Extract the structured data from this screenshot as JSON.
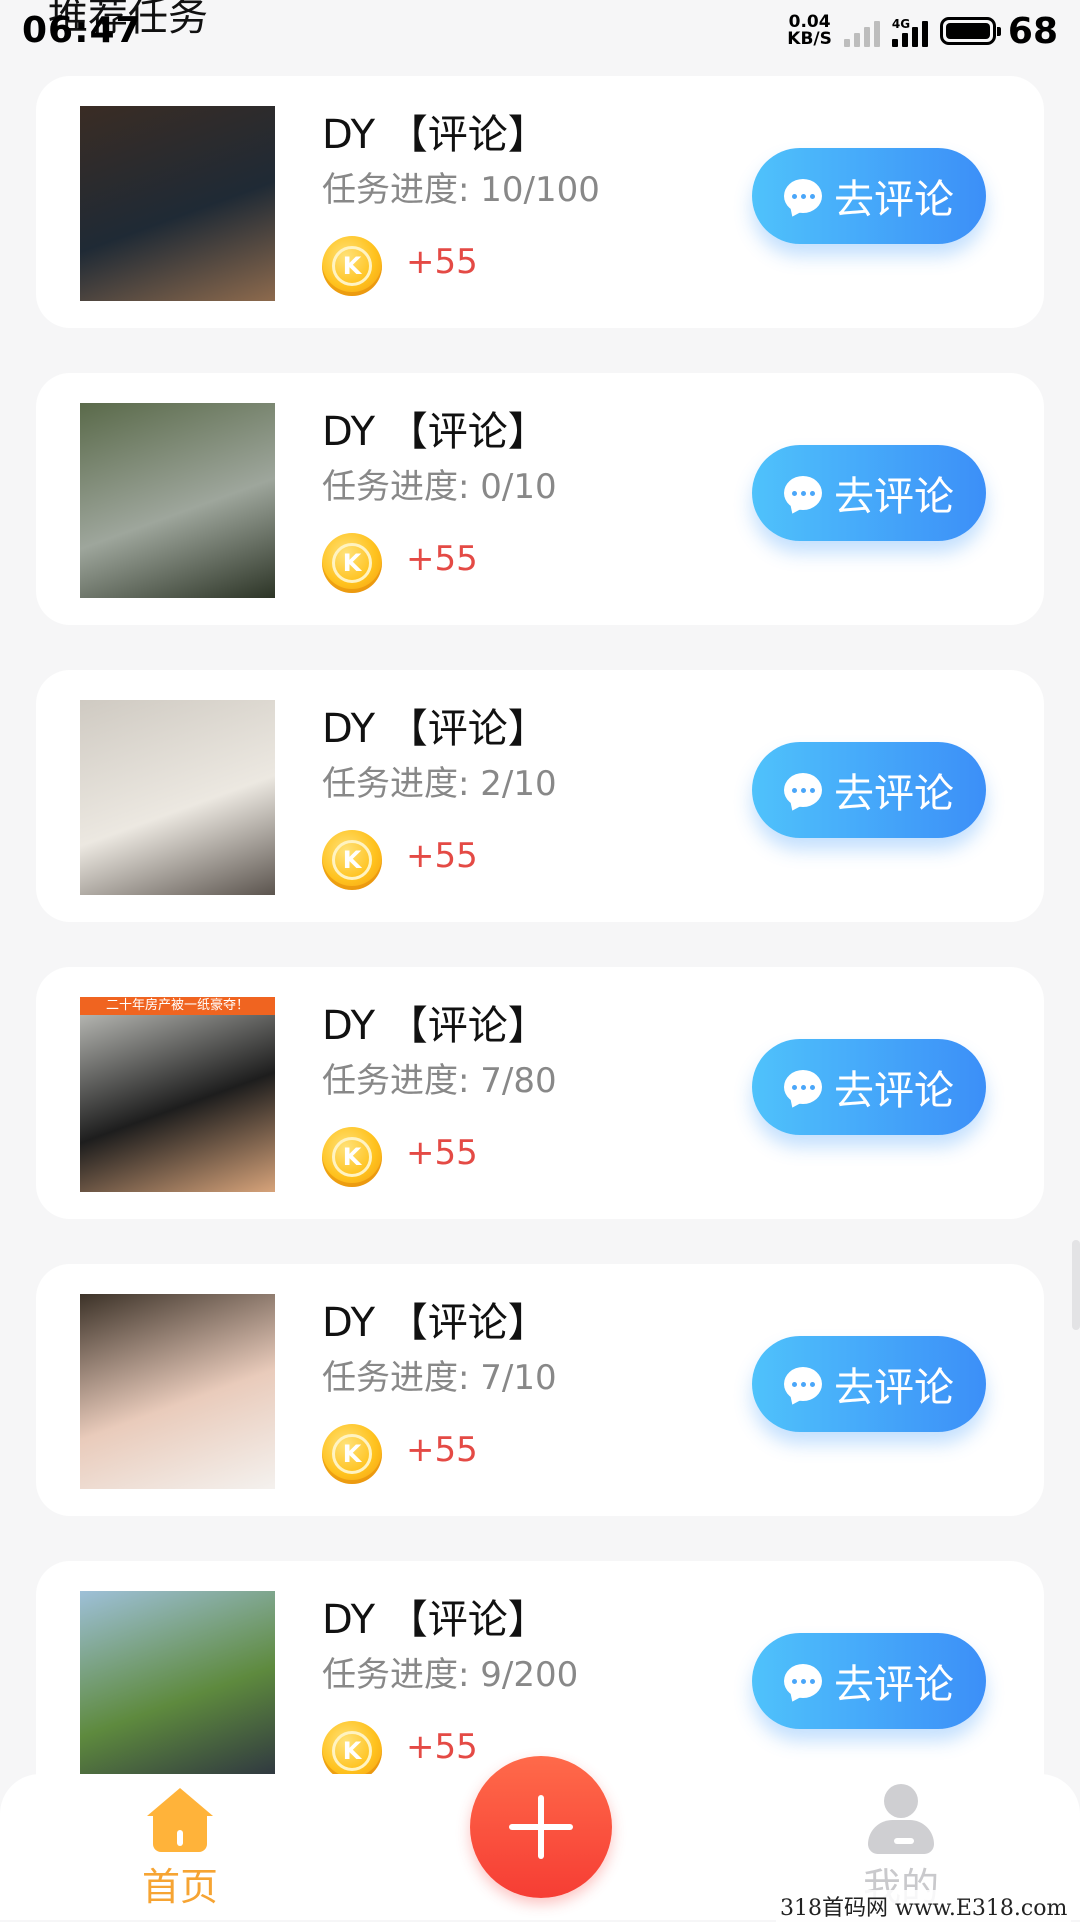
{
  "status_bar": {
    "time": "06:47",
    "net_speed_value": "0.04",
    "net_speed_unit": "KB/S",
    "network_type": "4G",
    "battery_level": "68"
  },
  "page": {
    "heading": "推荐任务"
  },
  "tasks": [
    {
      "title": "DY 【评论】",
      "progress": "任务进度: 10/100",
      "reward": "+55",
      "button_label": "去评论",
      "thumb_colors": [
        "#3a2c24",
        "#1f2a35",
        "#8d6a4d"
      ]
    },
    {
      "title": "DY 【评论】",
      "progress": "任务进度: 0/10",
      "reward": "+55",
      "button_label": "去评论",
      "thumb_colors": [
        "#5a6a4a",
        "#9ea69c",
        "#2c3426"
      ]
    },
    {
      "title": "DY 【评论】",
      "progress": "任务进度: 2/10",
      "reward": "+55",
      "button_label": "去评论",
      "thumb_colors": [
        "#cfcac2",
        "#ece8e1",
        "#5b544e"
      ]
    },
    {
      "title": "DY 【评论】",
      "progress": "任务进度: 7/80",
      "reward": "+55",
      "button_label": "去评论",
      "thumb_colors": [
        "#c8c9c4",
        "#1d1d1d",
        "#d7a37a"
      ],
      "thumb_banner": "二十年房产被一纸豪夺！"
    },
    {
      "title": "DY 【评论】",
      "progress": "任务进度: 7/10",
      "reward": "+55",
      "button_label": "去评论",
      "thumb_colors": [
        "#3c3228",
        "#e9cbbb",
        "#f4f1ee"
      ]
    },
    {
      "title": "DY 【评论】",
      "progress": "任务进度: 9/200",
      "reward": "+55",
      "button_label": "去评论",
      "thumb_colors": [
        "#9ec0d8",
        "#5e8a3e",
        "#2b3040"
      ]
    }
  ],
  "bottom_nav": {
    "home_label": "首页",
    "me_label": "我的"
  },
  "colors": {
    "accent_blue": "#3c8ff8",
    "reward_red": "#e44a45",
    "home_orange": "#f6a433",
    "add_red": "#f63d34"
  },
  "watermark": "318首码网 www.E318.com",
  "icons": {
    "coin": "k-coin-icon",
    "chat": "chat-bubble-icon",
    "home": "home-icon",
    "add": "plus-icon",
    "me": "user-icon"
  }
}
